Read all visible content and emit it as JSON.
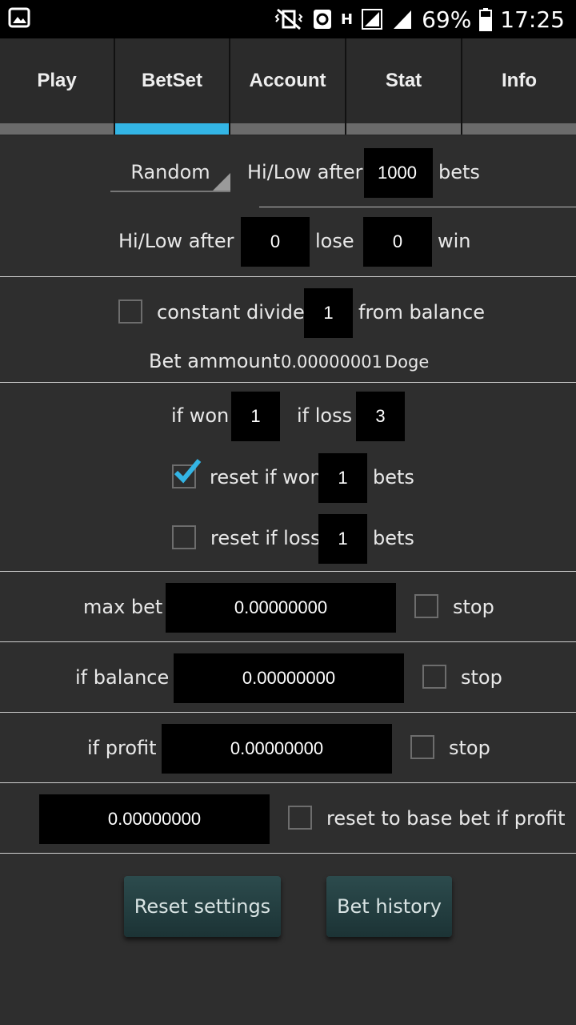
{
  "status_bar": {
    "battery": "69%",
    "time": "17:25",
    "net_label": "H"
  },
  "tabs": [
    {
      "label": "Play"
    },
    {
      "label": "BetSet"
    },
    {
      "label": "Account"
    },
    {
      "label": "Stat"
    },
    {
      "label": "Info"
    }
  ],
  "active_tab": "BetSet",
  "hilow": {
    "mode_select": "Random",
    "after_label": "Hi/Low after",
    "after_bets_value": "1000",
    "bets_label": "bets",
    "after2_label": "Hi/Low after",
    "lose_value": "0",
    "lose_label": "lose",
    "win_value": "0",
    "win_label": "win"
  },
  "divider_section": {
    "constant_label": "constant divider",
    "constant_checked": false,
    "divider_value": "1",
    "from_balance_label": "from balance",
    "bet_amount_label": "Bet ammount",
    "bet_amount_value": "0.00000001",
    "currency": "Doge"
  },
  "multipliers": {
    "if_won_label": "if won",
    "if_won_value": "1",
    "if_loss_label": "if loss",
    "if_loss_value": "3",
    "reset_won_label": "reset if won",
    "reset_won_checked": true,
    "reset_won_value": "1",
    "reset_won_bets": "bets",
    "reset_loss_label": "reset if loss",
    "reset_loss_checked": false,
    "reset_loss_value": "1",
    "reset_loss_bets": "bets"
  },
  "max_bet": {
    "label": "max bet",
    "value": "0.00000000",
    "stop_label": "stop"
  },
  "if_balance": {
    "label": "if balance",
    "value": "0.00000000",
    "stop_label": "stop"
  },
  "if_profit": {
    "label": "if profit",
    "value": "0.00000000",
    "stop_label": "stop"
  },
  "reset_profit": {
    "value": "0.00000000",
    "label": "reset to base bet if profit"
  },
  "buttons": {
    "reset_settings": "Reset settings",
    "bet_history": "Bet history"
  },
  "colors": {
    "accent": "#33b5e5",
    "background": "#2e2e2e",
    "field": "#000000"
  }
}
